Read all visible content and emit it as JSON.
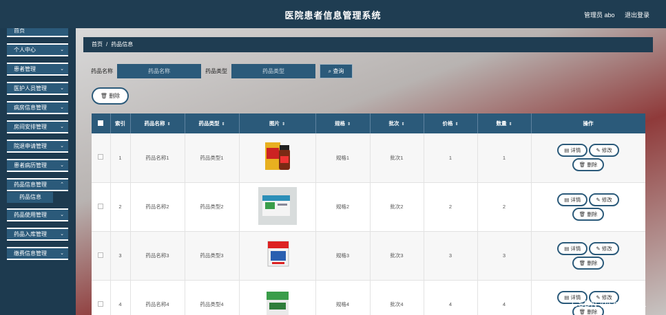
{
  "header": {
    "title": "医院患者信息管理系统",
    "user": "管理员 abo",
    "logout": "退出登录"
  },
  "sidebar": {
    "items": [
      "首页",
      "个人中心",
      "患者管理",
      "医护人员管理",
      "病房信息管理",
      "房间安排管理",
      "院退申请管理",
      "患者病历管理",
      "药品信息管理",
      "药品使用管理",
      "药品入库管理",
      "缴费信息管理"
    ],
    "sub_item": "药品信息"
  },
  "breadcrumb": {
    "home": "首页",
    "sep": "/",
    "current": "药品信息"
  },
  "search": {
    "name_label": "药品名称",
    "name_placeholder": "药品名称",
    "type_label": "药品类型",
    "type_placeholder": "药品类型",
    "button": "查询"
  },
  "delete_button": "删除",
  "table": {
    "headers": [
      "索引",
      "药品名称",
      "药品类型",
      "图片",
      "规格",
      "批次",
      "价格",
      "数量",
      "操作"
    ],
    "rows": [
      {
        "index": "1",
        "name": "药品名称1",
        "type": "药品类型1",
        "spec": "规格1",
        "batch": "批次1",
        "price": "1",
        "qty": "1"
      },
      {
        "index": "2",
        "name": "药品名称2",
        "type": "药品类型2",
        "spec": "规格2",
        "batch": "批次2",
        "price": "2",
        "qty": "2"
      },
      {
        "index": "3",
        "name": "药品名称3",
        "type": "药品类型3",
        "spec": "规格3",
        "batch": "批次3",
        "price": "3",
        "qty": "3"
      },
      {
        "index": "4",
        "name": "药品名称4",
        "type": "药品类型4",
        "spec": "规格4",
        "batch": "批次4",
        "price": "4",
        "qty": "4"
      }
    ],
    "actions": {
      "detail": "详情",
      "edit": "修改",
      "delete": "删除"
    }
  },
  "watermark": "CSDN @sheji1211"
}
